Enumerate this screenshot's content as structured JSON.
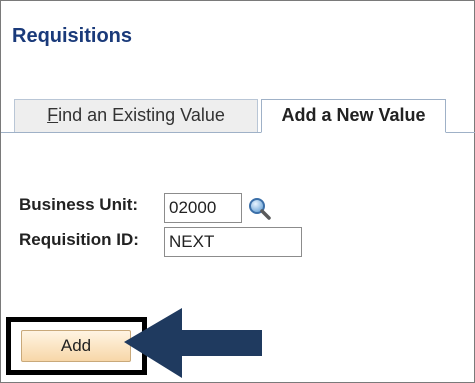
{
  "page": {
    "title": "Requisitions"
  },
  "tabs": {
    "find_prefix": "",
    "find_underlined": "F",
    "find_rest": "ind an Existing Value",
    "add_label": "Add a New Value"
  },
  "form": {
    "business_unit_label": "Business Unit:",
    "business_unit_value": "02000",
    "requisition_id_label": "Requisition ID:",
    "requisition_id_value": "NEXT"
  },
  "actions": {
    "add_label": "Add"
  },
  "icons": {
    "lookup": "magnifier-lookup-icon",
    "arrow": "left-arrow-callout-icon"
  },
  "colors": {
    "title": "#1a3a7a",
    "arrow": "#1f3a5f",
    "add_button_top": "#fff4e3",
    "add_button_bottom": "#f7d7a8"
  }
}
